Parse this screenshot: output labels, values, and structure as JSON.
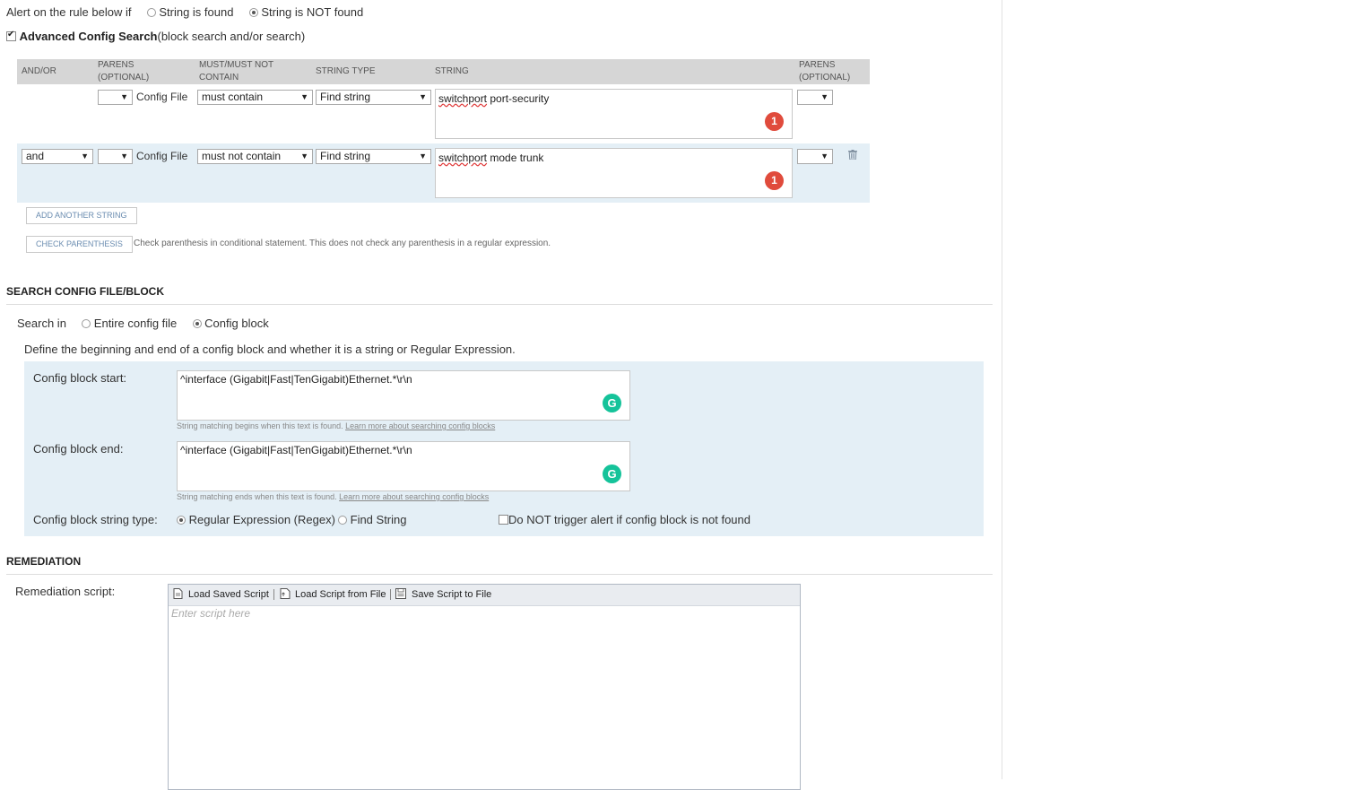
{
  "alert": {
    "label": "Alert on the rule below if",
    "option_found": "String is found",
    "option_not_found": "String is NOT found"
  },
  "advanced": {
    "title": "Advanced Config Search",
    "subtitle": "(block search and/or search)",
    "checked": true
  },
  "table": {
    "headers": {
      "andor": "AND/OR",
      "parens1_line1": "PARENS",
      "parens1_line2": "(OPTIONAL)",
      "must_line1": "MUST/MUST NOT",
      "must_line2": "CONTAIN",
      "string_type": "STRING TYPE",
      "string": "STRING",
      "parens2_line1": "PARENS",
      "parens2_line2": "(OPTIONAL)"
    },
    "rows": [
      {
        "andor": "",
        "parens_open": "",
        "source": "Config File",
        "must": "must contain",
        "string_type": "Find string",
        "string_word": "switchport",
        "string_rest": " port-security",
        "parens_close": "",
        "badge": "1"
      },
      {
        "andor": "and",
        "parens_open": "",
        "source": "Config File",
        "must": "must not contain",
        "string_type": "Find string",
        "string_word": "switchport",
        "string_rest": " mode trunk",
        "parens_close": "",
        "badge": "1"
      }
    ]
  },
  "buttons": {
    "add_string": "ADD ANOTHER STRING",
    "check_parens": "CHECK PARENTHESIS",
    "check_parens_note": "Check parenthesis in conditional statement. This does not check any parenthesis in a regular expression."
  },
  "search_block": {
    "title": "SEARCH CONFIG FILE/BLOCK",
    "search_in_label": "Search in",
    "option_entire": "Entire config file",
    "option_block": "Config block",
    "define_text": "Define the beginning and end of a config block and whether it is a string or Regular Expression.",
    "start_label": "Config block start:",
    "start_value": "^interface (Gigabit|Fast|TenGigabit)Ethernet.*\\r\\n",
    "start_hint": "String matching begins when this text is found.",
    "start_link": "Learn more about searching config blocks",
    "end_label": "Config block end:",
    "end_value": "^interface (Gigabit|Fast|TenGigabit)Ethernet.*\\r\\n",
    "end_hint": "String matching ends when this text is found.",
    "end_link": "Learn more about searching config blocks",
    "type_label": "Config block string type:",
    "option_regex": "Regular Expression (Regex)",
    "option_find": "Find String",
    "no_trigger_label": "Do NOT trigger alert if config block is not found",
    "grammarly_glyph": "G"
  },
  "remediation": {
    "title": "REMEDIATION",
    "script_label": "Remediation script:",
    "load_saved": "Load Saved Script",
    "load_file": "Load Script from File",
    "save_file": "Save Script to File",
    "placeholder": "Enter script here"
  }
}
